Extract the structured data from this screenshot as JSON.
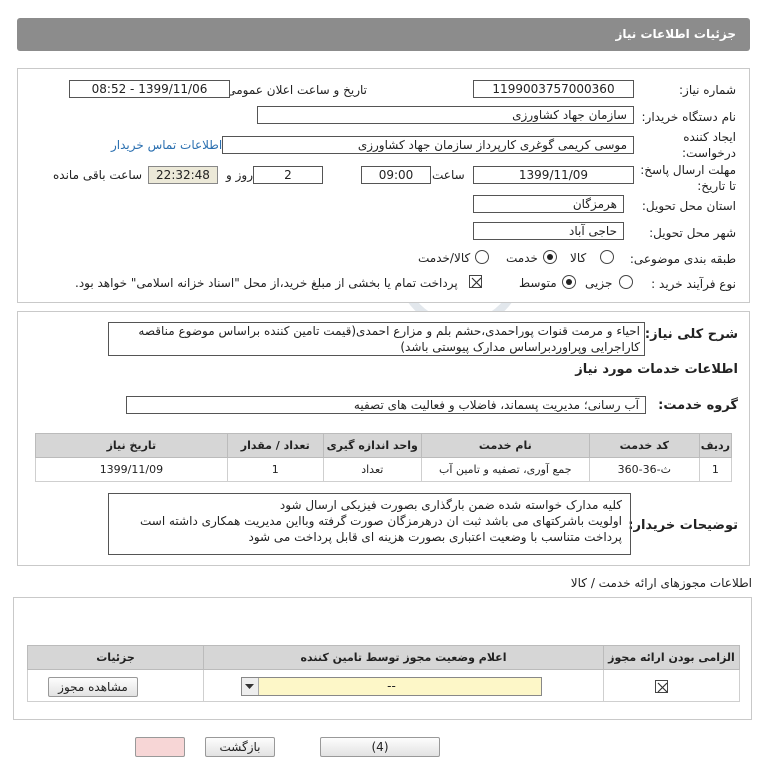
{
  "page": {
    "title": "جزئیات اطلاعات نیاز"
  },
  "info": {
    "need_number_label": "شماره نیاز:",
    "need_number": "1199003757000360",
    "announce_label": "تاریخ و ساعت اعلان عمومی:",
    "announce_value": "1399/11/06 - 08:52",
    "buyer_org_label": "نام دستگاه خریدار:",
    "buyer_org": "سازمان جهاد کشاورزی",
    "creator_label_1": "ایجاد کننده",
    "creator_label_2": "درخواست:",
    "creator": "موسی کریمی گوغری کارپرداز سازمان جهاد کشاورزی",
    "contact_link": "اطلاعات تماس خریدار",
    "deadline_label_1": "مهلت ارسال پاسخ:",
    "deadline_label_2": "تا تاریخ:",
    "deadline_date": "1399/11/09",
    "time_label": "ساعت",
    "deadline_time": "09:00",
    "days_value": "2",
    "days_label": "روز و",
    "remaining_time": "22:32:48",
    "remaining_label": "ساعت باقی مانده",
    "province_label": "استان محل تحویل:",
    "province": "هرمزگان",
    "city_label": "شهر محل تحویل:",
    "city": "حاجی آباد",
    "category_label": "طبقه بندی موضوعی:",
    "category_options": [
      "کالا",
      "خدمت",
      "کالا/خدمت"
    ],
    "category_selected": "خدمت",
    "process_label": "نوع فرآیند خرید :",
    "process_options": [
      "جزیی",
      "متوسط"
    ],
    "process_selected": "متوسط",
    "payment_note": "پرداخت تمام یا بخشی از مبلغ خرید،از محل \"اسناد خزانه اسلامی\" خواهد بود."
  },
  "summary": {
    "label": "شرح کلی نیاز:",
    "text": "احیاء و مرمت قنوات پوراحمدی،حشم بلم و مزارع احمدی(قیمت تامین کننده براساس موضوع مناقصه کاراجرایی وپراوردبراساس مدارک پیوستی باشد)"
  },
  "services": {
    "heading": "اطلاعات خدمات مورد نیاز",
    "group_label": "گروه خدمت:",
    "group_value": "آب رسانی؛ مدیریت پسماند، فاضلاب و فعالیت های تصفیه",
    "columns": [
      "ردیف",
      "کد خدمت",
      "نام خدمت",
      "واحد اندازه گیری",
      "تعداد / مقدار",
      "تاریخ نیاز"
    ],
    "rows": [
      [
        "1",
        "ث-36-360",
        "جمع آوری، تصفیه و تامین آب",
        "تعداد",
        "1",
        "1399/11/09"
      ]
    ]
  },
  "buyer_notes": {
    "label": "توضیحات خریدار:",
    "lines": [
      "کلیه مدارک خواسته شده ضمن بارگذاری بصورت فیزیکی ارسال شود",
      "اولویت باشرکتهای می باشد ثبت ان درهرمزگان صورت گرفته وبااین مدیریت همکاری داشته است",
      "پرداخت متناسب با وضعیت اعتباری بصورت هزینه ای قابل پرداخت می شود"
    ]
  },
  "permits": {
    "heading": "اطلاعات مجوزهای ارائه خدمت / کالا",
    "columns": [
      "الزامی بودن ارائه مجوز",
      "اعلام وضعیت مجوز توسط تامین کننده",
      "جزئیات"
    ],
    "select_value": "--",
    "view_button": "مشاهده مجوز"
  },
  "footer_buttons": [
    "(4)",
    "بازگشت"
  ],
  "colors": {
    "titlebar": "#8c8c8c",
    "link": "#2a6fb0",
    "table_header": "#d6d6d6",
    "select_bg": "#fdf7c8"
  }
}
